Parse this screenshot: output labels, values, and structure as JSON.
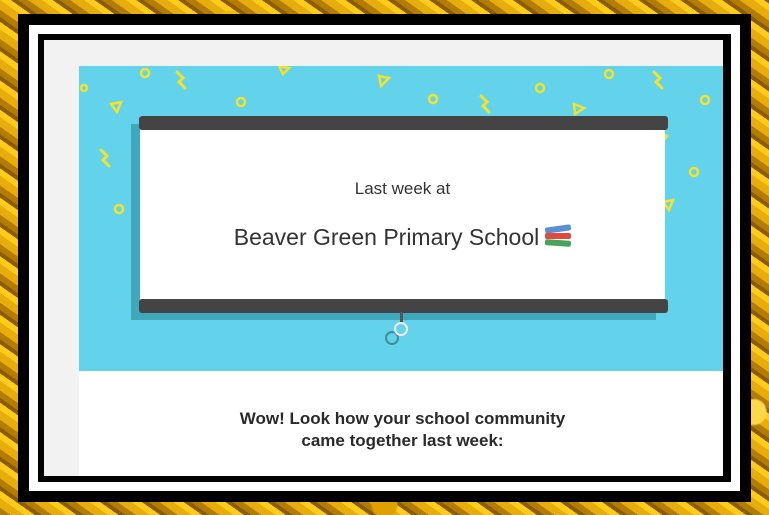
{
  "email": {
    "intro_text": "Last week at",
    "school_name": "Beaver Green Primary School",
    "school_emoji_icon": "books-icon",
    "headline_line1": "Wow! Look how your school community",
    "headline_line2": "came together last week:"
  },
  "colors": {
    "banner": "#62d3ea",
    "confetti": "#f5e22a",
    "board_bar": "#444444",
    "frame": "#000000"
  }
}
